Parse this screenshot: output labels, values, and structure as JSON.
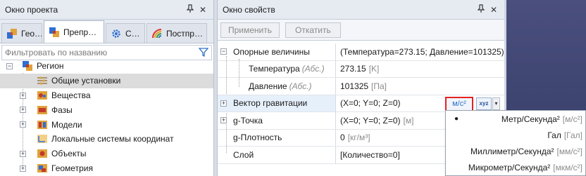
{
  "project_panel": {
    "title": "Окно проекта",
    "pin_label": "ᵖ",
    "close_label": "✕",
    "tabs": [
      {
        "label": "Гео…",
        "icon": "geometry-icon"
      },
      {
        "label": "Препр…",
        "icon": "preprocessor-icon"
      },
      {
        "label": "С…",
        "icon": "solver-gear-icon"
      },
      {
        "label": "Постпр…",
        "icon": "postprocessor-icon"
      }
    ],
    "filter_placeholder": "Фильтровать по названию",
    "tree": [
      {
        "label": "Регион",
        "expander": "⊟"
      },
      {
        "label": "Общие установки"
      },
      {
        "label": "Вещества",
        "expander": "+"
      },
      {
        "label": "Фазы",
        "expander": "+"
      },
      {
        "label": "Модели",
        "expander": "+"
      },
      {
        "label": "Локальные системы координат"
      },
      {
        "label": "Объекты",
        "expander": "+"
      },
      {
        "label": "Геометрия",
        "expander": "+"
      }
    ]
  },
  "properties_panel": {
    "title": "Окно свойств",
    "pin_label": "ᵖ",
    "close_label": "✕",
    "apply_label": "Применить",
    "revert_label": "Откатить",
    "rows": [
      {
        "name": "Опорные величины",
        "value": "(Температура=273.15; Давление=101325)",
        "expander": "−"
      },
      {
        "name": "Температура",
        "qual": "(Абс.)",
        "value": "273.15",
        "unit": "[K]"
      },
      {
        "name": "Давление",
        "qual": "(Абс.)",
        "value": "101325",
        "unit": "[Па]"
      },
      {
        "name": "Вектор гравитации",
        "value": "(X=0; Y=0; Z=0)",
        "expander": "+"
      },
      {
        "name": "g-Точка",
        "value": "(X=0; Y=0; Z=0)",
        "unit": "[м]",
        "expander": "+"
      },
      {
        "name": "g-Плотность",
        "value": "0",
        "unit": "[кг/м³]"
      },
      {
        "name": "Слой",
        "value": "[Количество=0]"
      }
    ],
    "unit_button_label": "м/с²",
    "xyz_label": "xyz",
    "dropdown_arrow": "▾"
  },
  "unit_dropdown": {
    "selected_marker": "●",
    "items": [
      {
        "label": "Метр/Секунда²",
        "unit": "[м/с²]",
        "selected": true
      },
      {
        "label": "Гал",
        "unit": "[Гал]",
        "selected": false
      },
      {
        "label": "Миллиметр/Секунда²",
        "unit": "[мм/с²]",
        "selected": false
      },
      {
        "label": "Микрометр/Секунда²",
        "unit": "[мкм/с²]",
        "selected": false
      }
    ]
  },
  "colors": {
    "accent_blue": "#2b6fc8",
    "highlight_red": "#e32222",
    "selection_gray": "#dcdcdc",
    "viewport_bg": "#3e4470"
  }
}
